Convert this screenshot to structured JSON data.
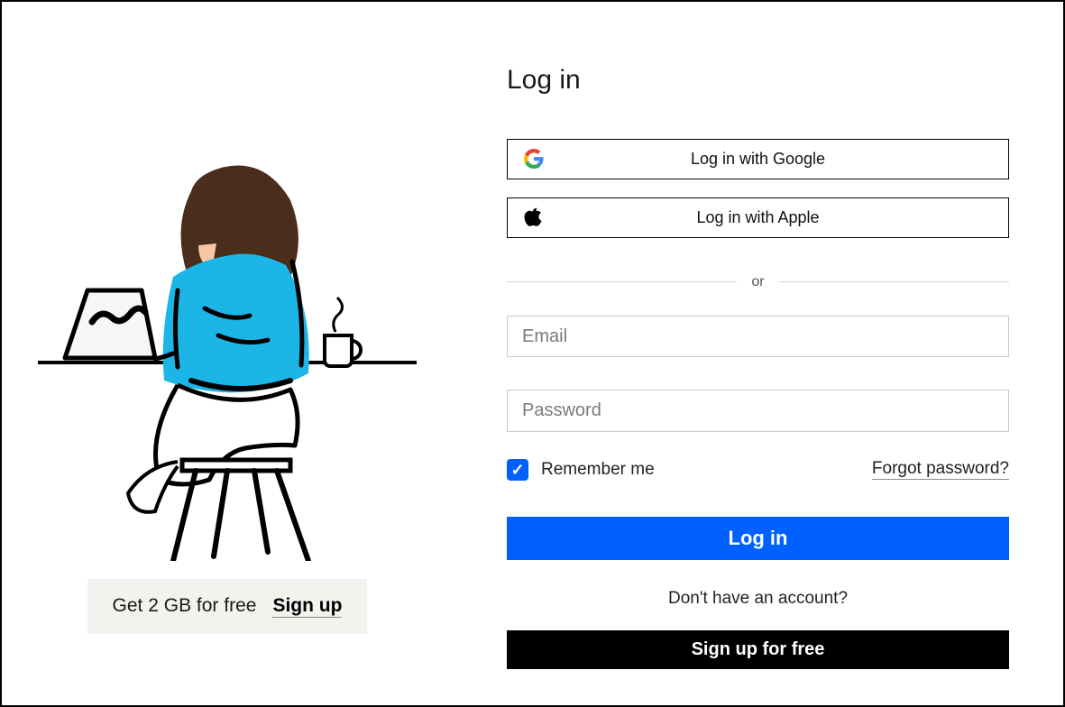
{
  "page": {
    "title": "Log in",
    "divider_label": "or",
    "no_account_text": "Don't have an account?"
  },
  "sso": {
    "google_label": "Log in with Google",
    "apple_label": "Log in with Apple"
  },
  "form": {
    "email_placeholder": "Email",
    "password_placeholder": "Password",
    "remember_label": "Remember me",
    "remember_checked": true,
    "forgot_label": "Forgot password?",
    "login_button": "Log in",
    "signup_free_button": "Sign up for free"
  },
  "promo": {
    "text": "Get 2 GB for free",
    "signup_label": "Sign up"
  }
}
